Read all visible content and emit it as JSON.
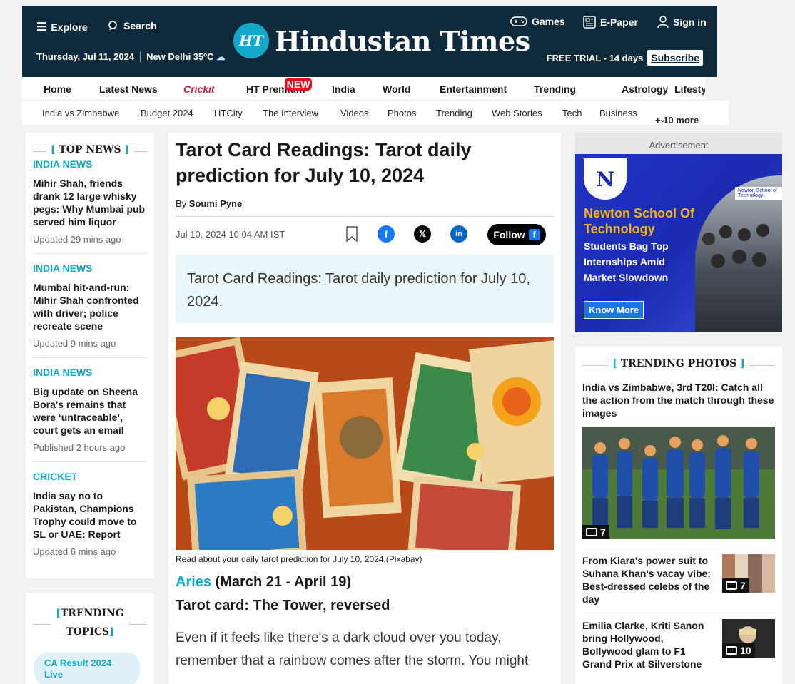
{
  "header": {
    "explore": "Explore",
    "search": "Search",
    "date": "Thursday, Jul 11, 2024",
    "weather": "New Delhi 35ºC",
    "logo_mark": "HT",
    "logo_text": "Hindustan Times",
    "games": "Games",
    "epaper": "E-Paper",
    "signin": "Sign in",
    "trial": "FREE TRIAL - 14 days",
    "subscribe": "Subscribe"
  },
  "nav_primary": [
    "Home",
    "Latest News",
    "Crickit",
    "HT Premium",
    "India",
    "World",
    "Entertainment",
    "Trending",
    "Astrology",
    "Lifesty"
  ],
  "nav_new_tag": "NEW",
  "nav_secondary": [
    "India vs Zimbabwe",
    "Budget 2024",
    "HTCity",
    "The Interview",
    "Videos",
    "Photos",
    "Trending",
    "Web Stories",
    "Tech",
    "Business",
    "+ 10 more"
  ],
  "top_news": {
    "title": "TOP NEWS",
    "items": [
      {
        "category": "INDIA NEWS",
        "title": "Mihir Shah, friends drank 12 large whisky pegs: Why Mumbai pub served him liquor",
        "time": "Updated 29 mins ago"
      },
      {
        "category": "INDIA NEWS",
        "title": "Mumbai hit-and-run: Mihir Shah confronted with driver; police recreate scene",
        "time": "Updated 9 mins ago"
      },
      {
        "category": "INDIA NEWS",
        "title": "Big update on Sheena Bora's remains that were ‘untraceable’, court gets an email",
        "time": "Published 2 hours ago"
      },
      {
        "category": "CRICKET",
        "title": "India say no to Pakistan, Champions Trophy could move to SL or UAE: Report",
        "time": "Updated 6 mins ago"
      }
    ]
  },
  "trending_topics": {
    "title_line1": "TRENDING",
    "title_line2": "TOPICS",
    "pill": "CA Result 2024 Live"
  },
  "article": {
    "headline": "Tarot Card Readings: Tarot daily prediction for July 10, 2024",
    "by": "By",
    "author": "Soumi Pyne",
    "date": "Jul 10, 2024 10:04 AM IST",
    "follow": "Follow",
    "summary": "Tarot Card Readings: Tarot daily prediction for July 10, 2024.",
    "caption": "Read about your daily tarot prediction for July 10, 2024.(Pixabay)",
    "sign": "Aries",
    "sign_dates": "(March 21 - April 19)",
    "card": "Tarot card: The Tower, reversed",
    "body": "Even if it feels like there's a dark cloud over you today, remember that a rainbow comes after the storm. You might"
  },
  "ad": {
    "label": "Advertisement",
    "title": "Newton School Of Technology",
    "subtitle": "Students Bag Top Internships Amid Market Slowdown",
    "button": "Know More",
    "mini_logo": "Newton School of Technology"
  },
  "trending_photos": {
    "title": "TRENDING PHOTOS",
    "main": {
      "title": "India vs Zimbabwe, 3rd T20I: Catch all the action from the match through these images",
      "count": "7"
    },
    "items": [
      {
        "title": "From Kiara's power suit to Suhana Khan's vacay vibe: Best-dressed celebs of the day",
        "count": "7"
      },
      {
        "title": "Emilia Clarke, Kriti Sanon bring Hollywood, Bollywood glam to F1 Grand Prix at Silverstone",
        "count": "10"
      }
    ]
  },
  "colors": {
    "brand_dark": "#0f2a3a",
    "accent": "#13a8c9"
  }
}
